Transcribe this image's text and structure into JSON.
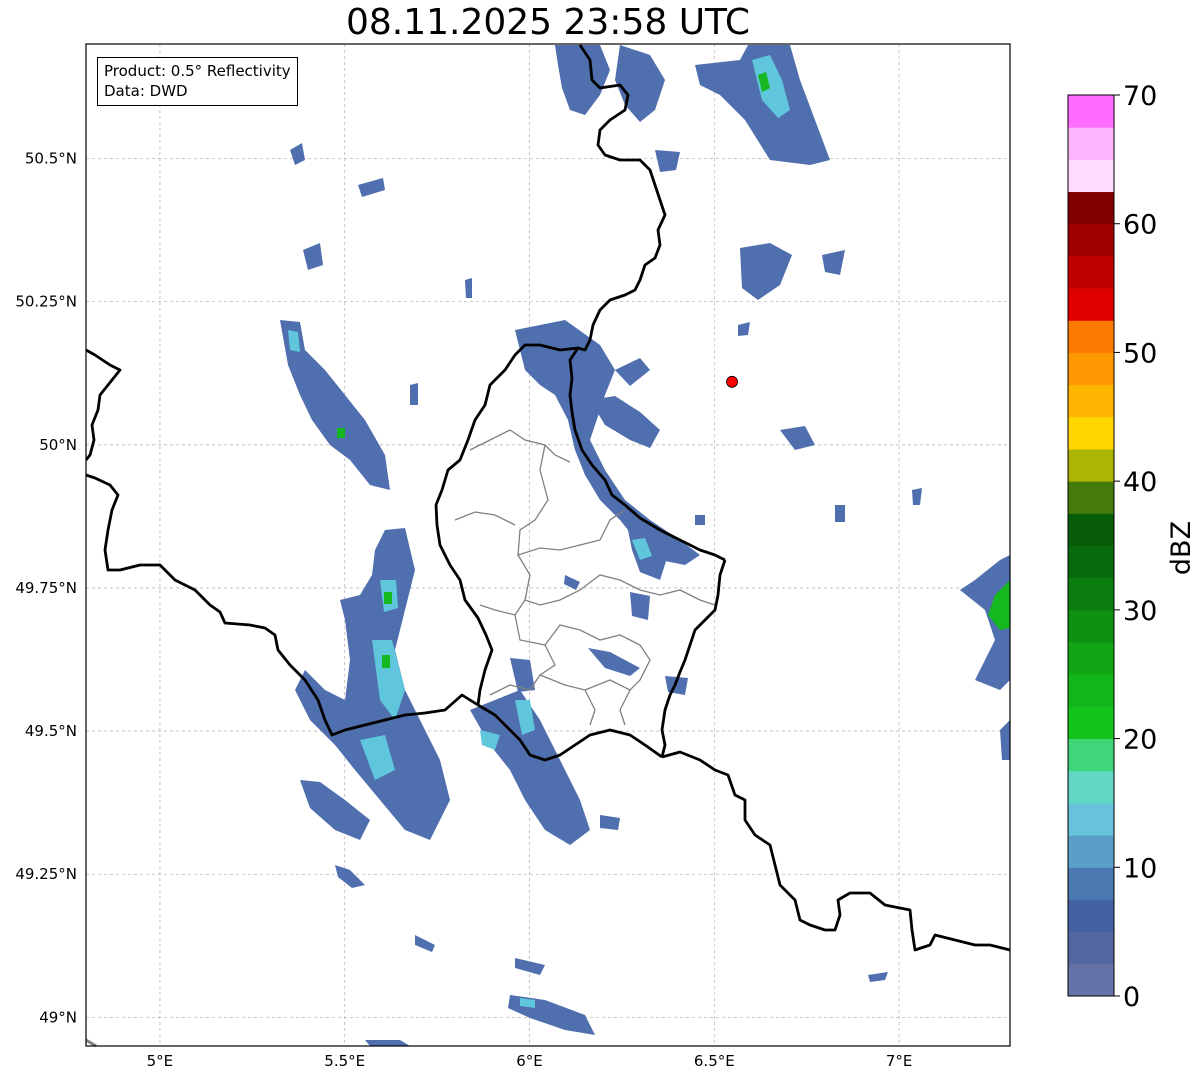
{
  "title": "08.11.2025 23:58 UTC",
  "info_box": {
    "product": "Product: 0.5° Reflectivity",
    "data": "Data: DWD"
  },
  "map": {
    "lon_range": [
      4.8,
      7.3
    ],
    "lat_range": [
      48.95,
      50.7
    ],
    "lon_ticks": [
      {
        "value": 5.0,
        "label": "5°E"
      },
      {
        "value": 5.5,
        "label": "5.5°E"
      },
      {
        "value": 6.0,
        "label": "6°E"
      },
      {
        "value": 6.5,
        "label": "6.5°E"
      },
      {
        "value": 7.0,
        "label": "7°E"
      }
    ],
    "lat_ticks": [
      {
        "value": 49.0,
        "label": "49°N"
      },
      {
        "value": 49.25,
        "label": "49.25°N"
      },
      {
        "value": 49.5,
        "label": "49.5°N"
      },
      {
        "value": 49.75,
        "label": "49.75°N"
      },
      {
        "value": 50.0,
        "label": "50°N"
      },
      {
        "value": 50.25,
        "label": "50.25°N"
      },
      {
        "value": 50.5,
        "label": "50.5°N"
      }
    ],
    "grid": true,
    "radar_site": {
      "lon": 6.548,
      "lat": 50.11,
      "color": "#ff0000"
    }
  },
  "colorbar": {
    "label": "dBZ",
    "min": 0,
    "max": 70,
    "step": 2.5,
    "tick_values": [
      0,
      10,
      20,
      30,
      40,
      50,
      60,
      70
    ],
    "colors": [
      "#6474a8",
      "#5367a0",
      "#4461a4",
      "#4a78b0",
      "#5a9fc8",
      "#68c2dc",
      "#62d7c5",
      "#3fd67a",
      "#12c51b",
      "#12b51a",
      "#12a615",
      "#0e9011",
      "#0a7d0e",
      "#076b0b",
      "#065c09",
      "#467a0a",
      "#adb504",
      "#ffd700",
      "#ffb400",
      "#ff9800",
      "#ff7a00",
      "#e00000",
      "#c00000",
      "#a00000",
      "#800000",
      "#ffdcff",
      "#ffb4ff",
      "#ff6cff",
      "#ee38ee"
    ]
  },
  "colors": {
    "border": "#000000",
    "admin": "#808080",
    "grid": "#b8b8b8",
    "echo_weak": "#4f6fae",
    "echo_mid": "#5fc6dc",
    "echo_strong": "#16b820"
  }
}
